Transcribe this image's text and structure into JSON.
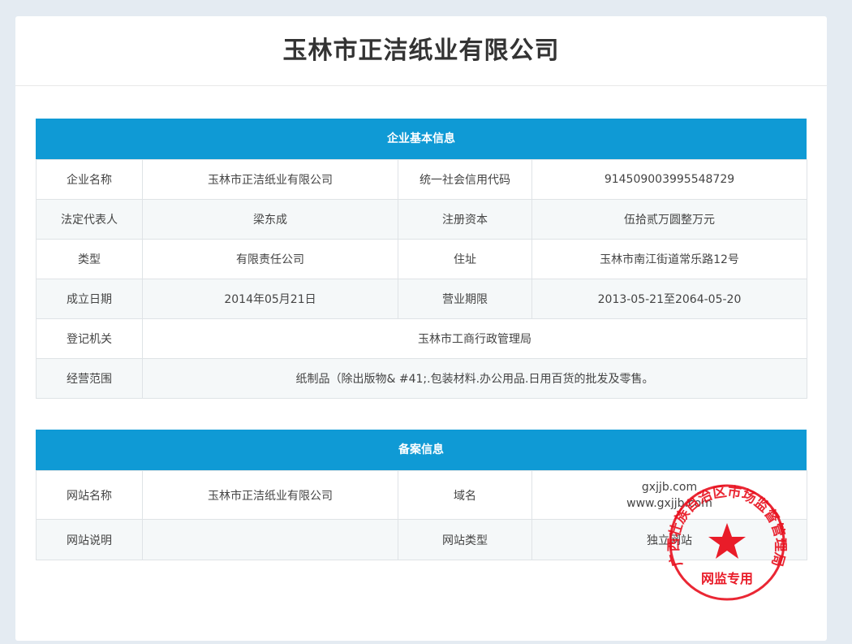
{
  "page": {
    "title": "玉林市正洁纸业有限公司"
  },
  "basic": {
    "header": "企业基本信息",
    "rows": [
      [
        {
          "label": "企业名称",
          "value": "玉林市正洁纸业有限公司"
        },
        {
          "label": "统一社会信用代码",
          "value": "914509003995548729"
        }
      ],
      [
        {
          "label": "法定代表人",
          "value": "梁东成"
        },
        {
          "label": "注册资本",
          "value": "伍拾贰万圆整万元"
        }
      ],
      [
        {
          "label": "类型",
          "value": "有限责任公司"
        },
        {
          "label": "住址",
          "value": "玉林市南江街道常乐路12号"
        }
      ],
      [
        {
          "label": "成立日期",
          "value": "2014年05月21日"
        },
        {
          "label": "营业期限",
          "value": "2013-05-21至2064-05-20"
        }
      ]
    ],
    "authority": {
      "label": "登记机关",
      "value": "玉林市工商行政管理局"
    },
    "scope": {
      "label": "经营范围",
      "value": "纸制品（除出版物& #41;.包装材料.办公用品.日用百货的批发及零售。"
    }
  },
  "filing": {
    "header": "备案信息",
    "site_name": {
      "label": "网站名称",
      "value": "玉林市正洁纸业有限公司"
    },
    "domain": {
      "label": "域名",
      "values": [
        "gxjjb.com",
        "www.gxjjb.com"
      ]
    },
    "site_desc": {
      "label": "网站说明",
      "value": ""
    },
    "site_type": {
      "label": "网站类型",
      "value": "独立网站"
    }
  },
  "seal": {
    "arc_text": "广西壮族自治区市场监督管理局",
    "bottom_text": "网监专用",
    "color": "#e8101e"
  },
  "colors": {
    "header_bg": "#0f9ad5",
    "page_bg": "#e4ebf2"
  }
}
